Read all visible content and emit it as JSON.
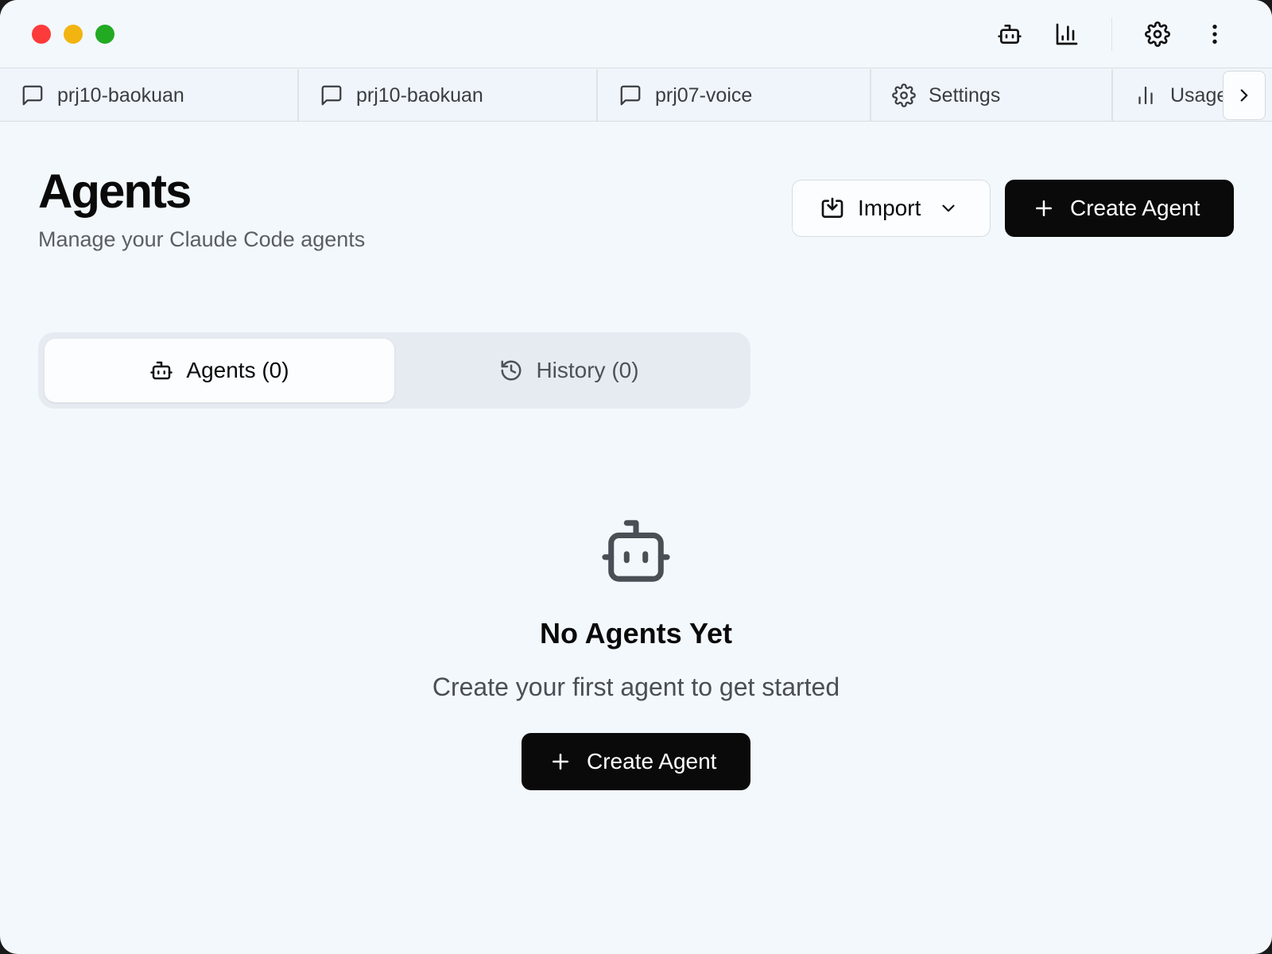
{
  "window": {
    "controls": [
      "close",
      "minimize",
      "maximize"
    ]
  },
  "toolbar": {
    "icons": [
      "bot-icon",
      "bar-chart-icon",
      "gear-icon",
      "more-vertical-icon"
    ]
  },
  "tabs": [
    {
      "label": "prj10-baokuan",
      "icon": "message-square-icon"
    },
    {
      "label": "prj10-baokuan",
      "icon": "message-square-icon"
    },
    {
      "label": "prj07-voice",
      "icon": "message-square-icon"
    },
    {
      "label": "Settings",
      "icon": "gear-icon"
    },
    {
      "label": "Usage",
      "icon": "bar-chart-icon"
    }
  ],
  "header": {
    "title": "Agents",
    "subtitle": "Manage your Claude Code agents",
    "import_label": "Import",
    "create_label": "Create Agent"
  },
  "segments": {
    "agents": "Agents (0)",
    "history": "History (0)",
    "active": "agents"
  },
  "empty_state": {
    "title": "No Agents Yet",
    "text": "Create your first agent to get started",
    "button_label": "Create Agent"
  },
  "colors": {
    "background": "#f3f8fd",
    "primary": "#0a0a0a",
    "traffic_red": "#fe3b3b",
    "traffic_yellow": "#f2b411",
    "traffic_green": "#22aa22"
  }
}
